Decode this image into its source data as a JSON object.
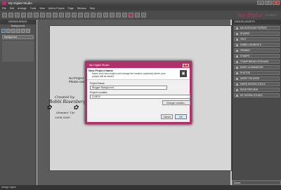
{
  "window": {
    "title": "My Digital Studio"
  },
  "menu": [
    "File",
    "Edit",
    "Arrange",
    "Tools",
    "View",
    "Add to Project",
    "Page",
    "Window",
    "Help"
  ],
  "logo": {
    "script": "my digital",
    "studio": "STUDIO"
  },
  "left_panel": {
    "title": "DESIGN SPACE",
    "sub": "Backgrounds",
    "layer": "Background"
  },
  "status_left": "Design Space",
  "canvas": {
    "message_line1": "No Project",
    "message_line2": "Please use"
  },
  "watermark": {
    "line1": "Created by",
    "line2": "Bobbi Rosenberg",
    "line3": "Stampin' Up!",
    "line4": "2008-2009"
  },
  "right_panel": {
    "title": "DESIGN ASSETS",
    "items": [
      "BACKGROUND PAPERS",
      "SHAPES",
      "TEXT",
      "EMBELLISHMENTS",
      "FRAMES",
      "STAMPS",
      "STAMP BRUSH STROKES",
      "MUSIC & ANIMATION",
      "PHOTOS",
      "ASSET FOLDERS",
      "MORE DESIGN TOOLS",
      "PAGE PREVIEW",
      "MY DIGITAL STUDIO"
    ],
    "bottom": "Zoom:"
  },
  "dialog": {
    "title": "My Digital Studio",
    "close": "X",
    "heading": "New Project Name",
    "description": "Name your new project and change the location (optional) where your project will be saved.",
    "name_label": "Project Name:",
    "name_value": "Blogger Background",
    "location_label": "Project Location:",
    "location_value": "D:\\MDS",
    "change_location": "Change Location...",
    "cancel": "Cancel",
    "ok": "OK"
  },
  "colors": {
    "accent": "#b0306a",
    "panel": "#4a4a4a"
  }
}
